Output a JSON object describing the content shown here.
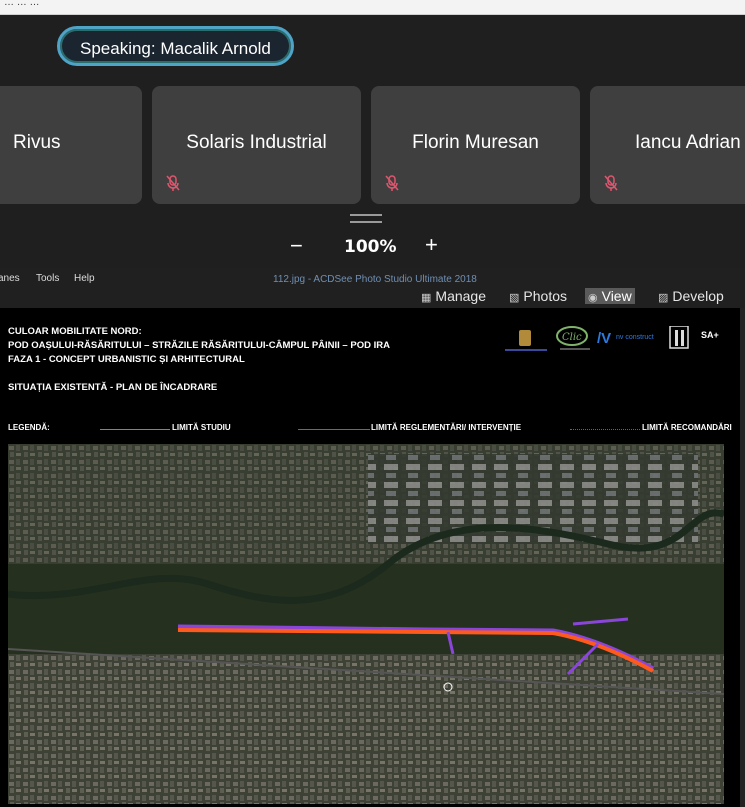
{
  "window": {
    "crumb": "…  …   …"
  },
  "call": {
    "speaking": "Speaking: Macalik Arnold",
    "participants": [
      {
        "name": "Rivus",
        "muted": false
      },
      {
        "name": "Solaris Industrial",
        "muted": true
      },
      {
        "name": "Florin Muresan",
        "muted": true
      },
      {
        "name": "Iancu Adrian",
        "muted": true
      }
    ],
    "zoom": "100%",
    "minus": "−",
    "plus": "+"
  },
  "acdsee": {
    "menu": [
      "anes",
      "Tools",
      "Help"
    ],
    "title": "112.jpg - ACDSee Photo Studio Ultimate 2018",
    "modes": {
      "manage": "Manage",
      "photos": "Photos",
      "view": "View",
      "develop": "Develop"
    }
  },
  "document": {
    "title1": "CULOAR MOBILITATE NORD:",
    "title2": "POD OAȘULUI-RĂSĂRITULUI – STRĂZILE RĂSĂRITULUI-CÂMPUL PÂINII – POD IRA",
    "title3": "FAZA 1 - CONCEPT URBANISTIC ȘI ARHITECTURAL",
    "subtitle": "SITUAȚIA EXISTENTĂ - PLAN DE ÎNCADRARE",
    "legend": "LEGENDĂ:",
    "legend_study": "LIMITĂ STUDIU",
    "legend_reg": "LIMITĂ REGLEMENTĂRI/ INTERVENȚIE",
    "legend_rec": "LIMITĂ RECOMANDĂRI",
    "logo_clic": "Clic",
    "logo_nv": "nv construct",
    "logo_sa": "SA+"
  },
  "colors": {
    "accent_ring": "#4fa3c7",
    "mic_muted": "#e0566f",
    "legend_study": "#7f7fa0",
    "legend_reg": "#8a46d8",
    "legend_rec": "#d23a2f",
    "route_orange": "#ff5a1e",
    "route_purple": "#8a46d8"
  }
}
